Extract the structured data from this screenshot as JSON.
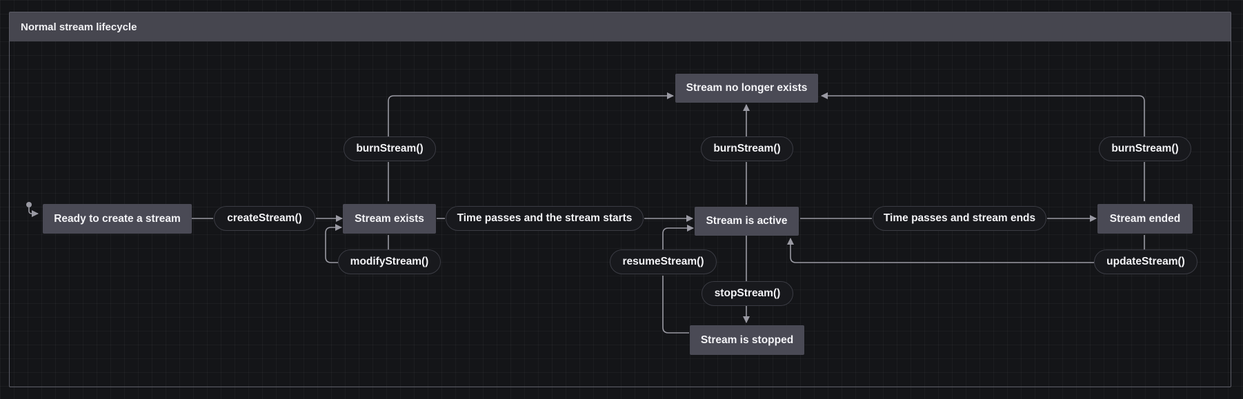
{
  "diagram": {
    "title": "Normal stream lifecycle",
    "states": {
      "ready": "Ready to create a stream",
      "exists": "Stream exists",
      "active": "Stream is active",
      "ended": "Stream ended",
      "gone": "Stream no longer exists",
      "stopped": "Stream is stopped"
    },
    "transitions": {
      "create": "createStream()",
      "modify": "modifyStream()",
      "starts": "Time passes and the stream starts",
      "ends": "Time passes and stream ends",
      "burn_exists": "burnStream()",
      "burn_active": "burnStream()",
      "burn_ended": "burnStream()",
      "resume": "resumeStream()",
      "stop": "stopStream()",
      "update": "updateStream()"
    }
  }
}
